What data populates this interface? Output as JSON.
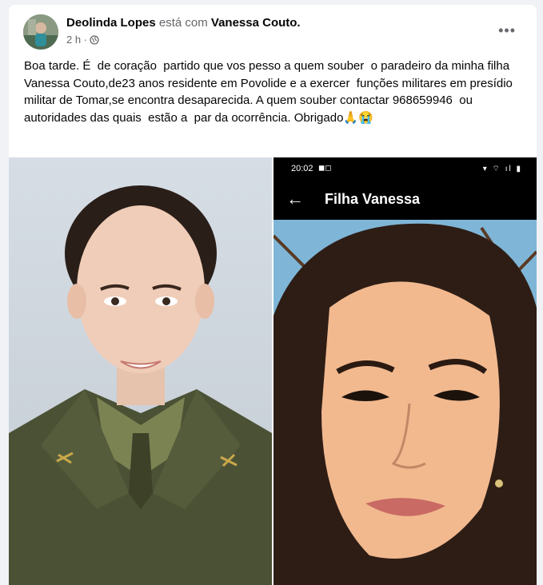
{
  "post": {
    "author": "Deolinda Lopes",
    "with_text": "está com",
    "tagged": "Vanessa Couto.",
    "time": "2 h ·",
    "privacy_icon": "globe-icon",
    "more_label": "•••",
    "text": "Boa tarde. É  de coração  partido que vos pesso a quem souber  o paradeiro da minha filha Vanessa Couto,de23 anos residente em Povolide e a exercer  funções militares em presídio militar de Tomar,se encontra desaparecida. A quem souber contactar 968659946  ou autoridades das quais  estão a  par da ocorrência. Obrigado🙏😭"
  },
  "phone": {
    "time": "20:02",
    "status_icons": "◼◻",
    "sys_icons": "▾ ⌔ ıl ▮",
    "back_icon": "←",
    "chat_title": "Filha Vanessa"
  },
  "colors": {
    "uniform": "#4b5134",
    "accent_text": "#050505",
    "secondary_text": "#65676b"
  }
}
